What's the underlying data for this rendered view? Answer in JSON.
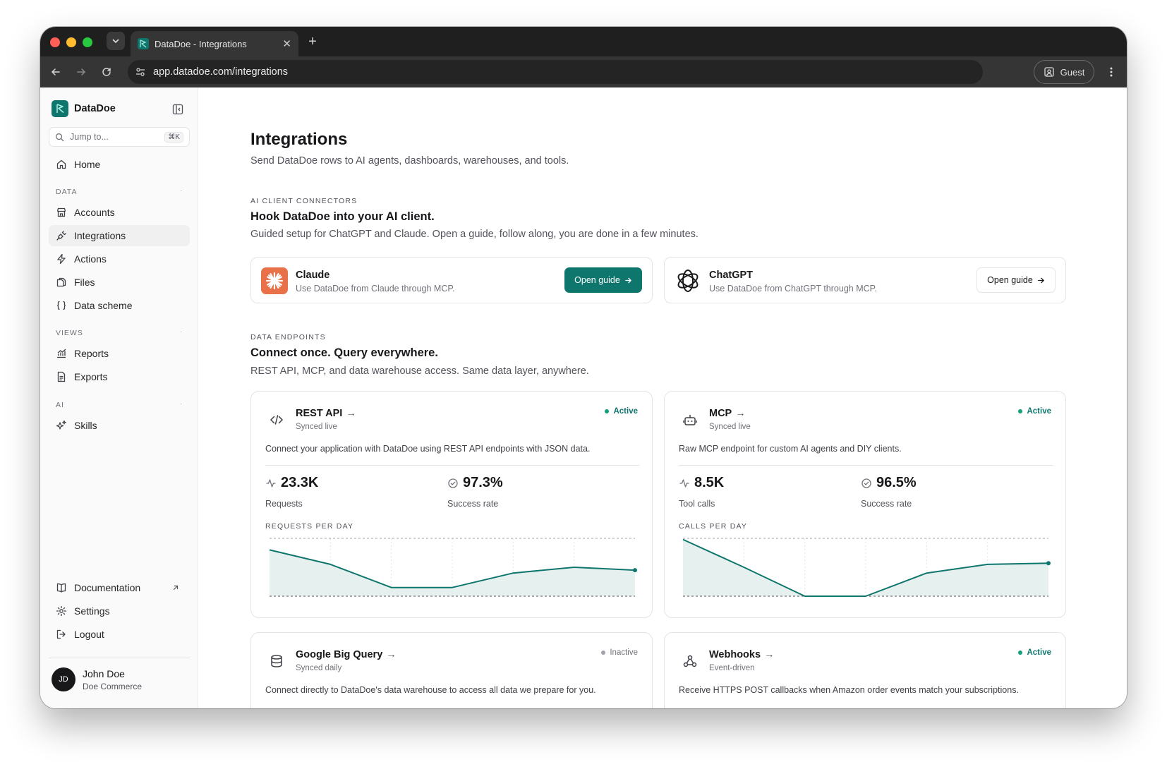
{
  "browser": {
    "tab_title": "DataDoe - Integrations",
    "url": "app.datadoe.com/integrations",
    "profile_label": "Guest"
  },
  "sidebar": {
    "brand": "DataDoe",
    "search_placeholder": "Jump to...",
    "search_shortcut": "⌘K",
    "home": "Home",
    "sections": {
      "data": "DATA",
      "views": "VIEWS",
      "ai": "AI"
    },
    "data_items": [
      "Accounts",
      "Integrations",
      "Actions",
      "Files",
      "Data scheme"
    ],
    "views_items": [
      "Reports",
      "Exports"
    ],
    "ai_items": [
      "Skills"
    ],
    "footer_items": [
      "Documentation",
      "Settings",
      "Logout"
    ],
    "user": {
      "initials": "JD",
      "name": "John Doe",
      "org": "Doe Commerce"
    }
  },
  "page": {
    "title": "Integrations",
    "subtitle": "Send DataDoe rows to AI agents, dashboards, warehouses, and tools."
  },
  "ai_connectors": {
    "eyebrow": "AI CLIENT CONNECTORS",
    "title": "Hook DataDoe into your AI client.",
    "description": "Guided setup for ChatGPT and Claude. Open a guide, follow along, you are done in a few minutes.",
    "cards": [
      {
        "name": "Claude",
        "desc": "Use DataDoe from Claude through MCP.",
        "button": "Open guide"
      },
      {
        "name": "ChatGPT",
        "desc": "Use DataDoe from ChatGPT through MCP.",
        "button": "Open guide"
      }
    ]
  },
  "endpoints": {
    "eyebrow": "DATA ENDPOINTS",
    "title": "Connect once. Query everywhere.",
    "description": "REST API, MCP, and data warehouse access. Same data layer, anywhere.",
    "cards": [
      {
        "name": "REST API",
        "arrow": "→",
        "sync": "Synced live",
        "status": "Active",
        "desc": "Connect your application with DataDoe using REST API endpoints with JSON data.",
        "stat1_value": "23.3K",
        "stat1_label": "Requests",
        "stat2_value": "97.3%",
        "stat2_label": "Success rate",
        "chart_label": "REQUESTS PER DAY"
      },
      {
        "name": "MCP",
        "arrow": "→",
        "sync": "Synced live",
        "status": "Active",
        "desc": "Raw MCP endpoint for custom AI agents and DIY clients.",
        "stat1_value": "8.5K",
        "stat1_label": "Tool calls",
        "stat2_value": "96.5%",
        "stat2_label": "Success rate",
        "chart_label": "CALLS PER DAY"
      },
      {
        "name": "Google Big Query",
        "arrow": "→",
        "sync": "Synced daily",
        "status": "Inactive",
        "desc": "Connect directly to DataDoe's data warehouse to access all data we prepare for you."
      },
      {
        "name": "Webhooks",
        "arrow": "→",
        "sync": "Event-driven",
        "status": "Active",
        "desc": "Receive HTTPS POST callbacks when Amazon order events match your subscriptions."
      }
    ]
  },
  "colors": {
    "accent": "#0f766e",
    "status_active": "#0f9f7a",
    "chart_fill": "#e6f0ee",
    "claude_orange": "#e8714a"
  },
  "chart_data": [
    {
      "type": "area",
      "x": [
        1,
        2,
        3,
        4,
        5,
        6,
        7
      ],
      "values": [
        80,
        55,
        15,
        15,
        40,
        50,
        45
      ],
      "ylim": [
        0,
        100
      ]
    },
    {
      "type": "area",
      "x": [
        1,
        2,
        3,
        4,
        5,
        6,
        7
      ],
      "values": [
        98,
        50,
        0,
        0,
        40,
        55,
        57
      ],
      "ylim": [
        0,
        100
      ]
    }
  ]
}
